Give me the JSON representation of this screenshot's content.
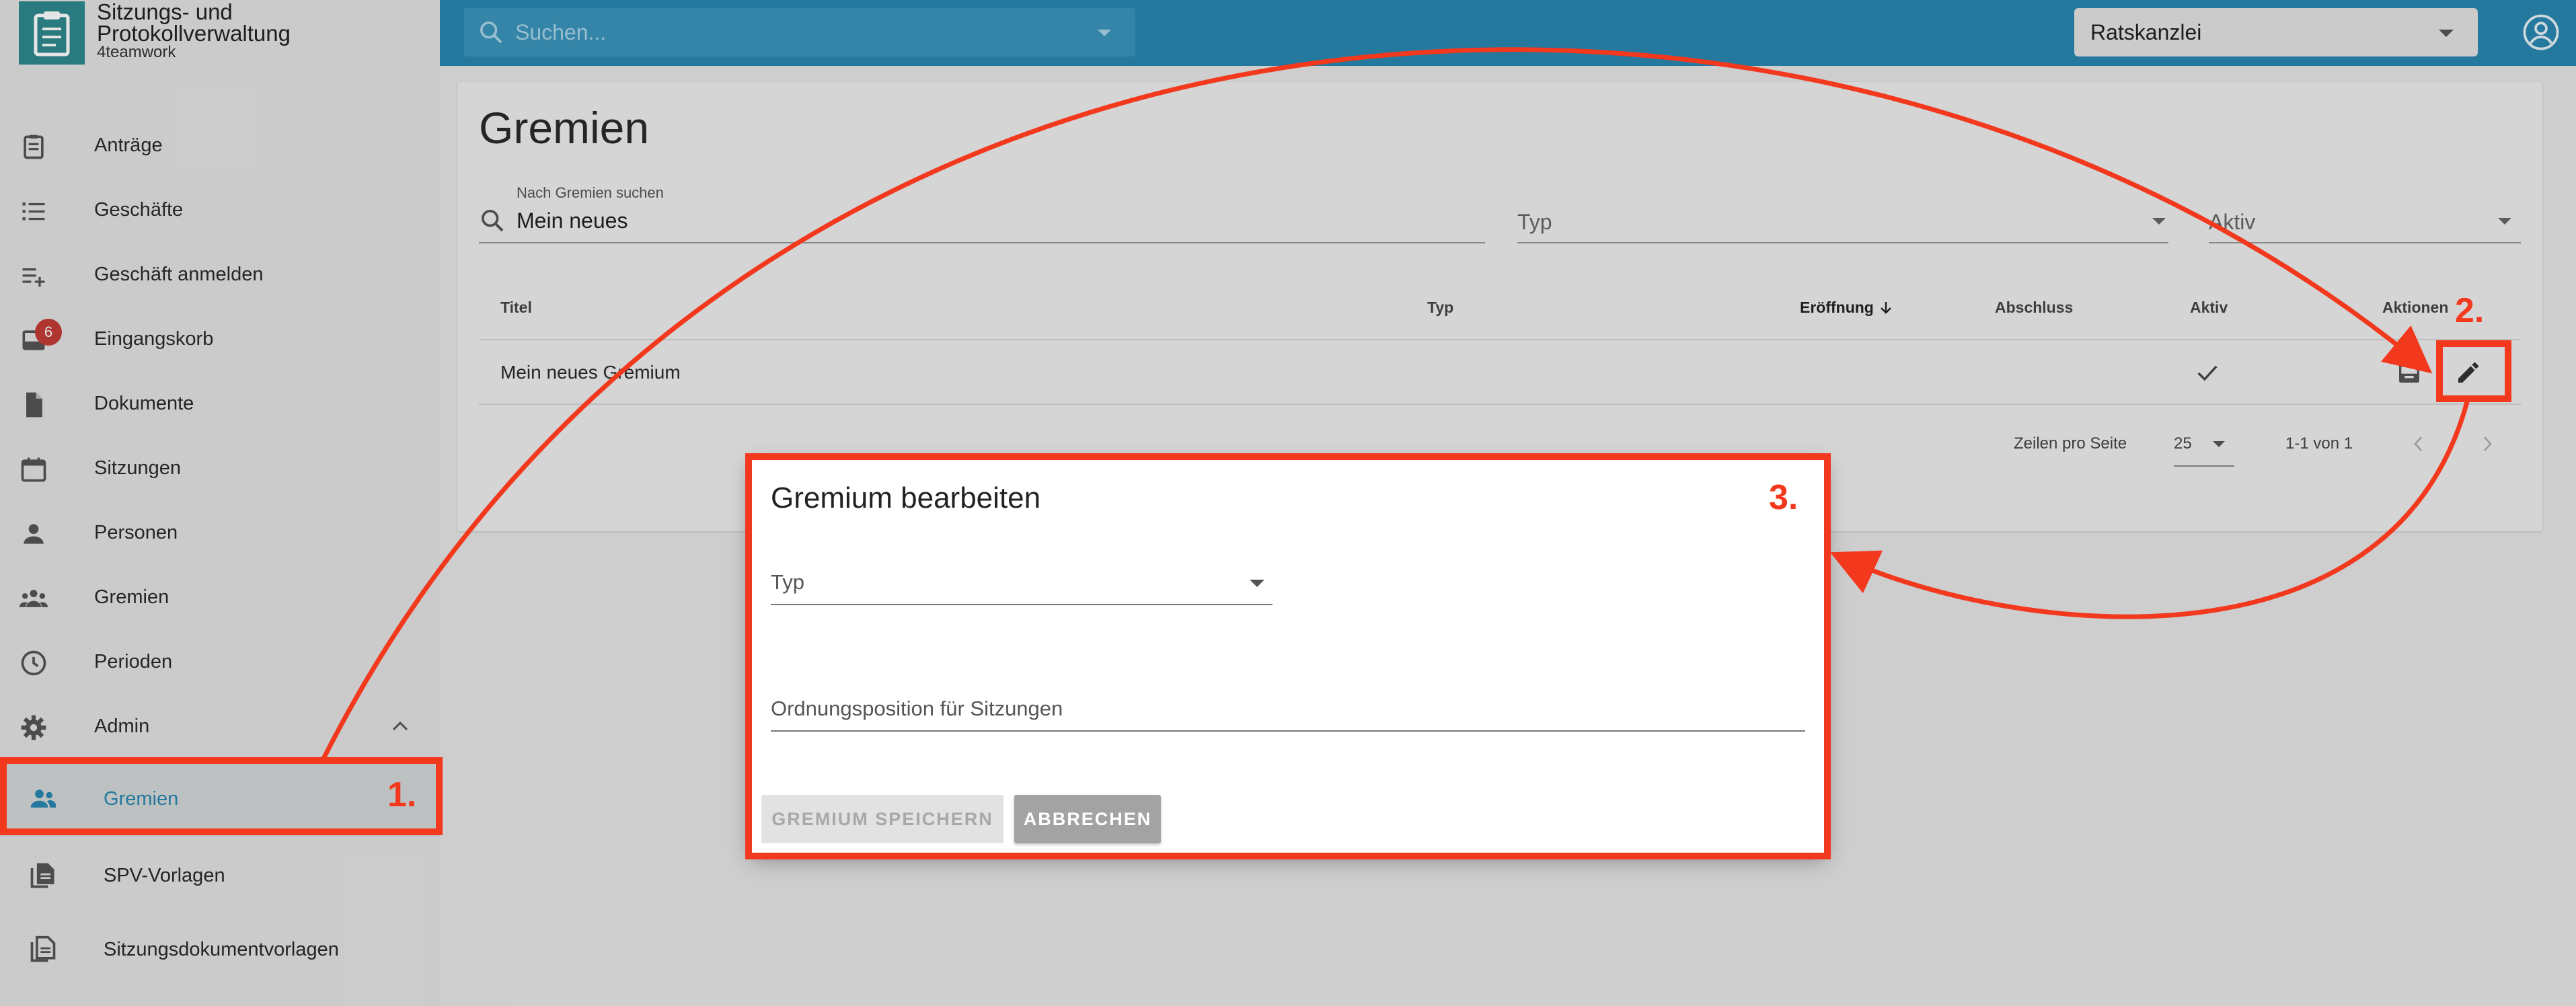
{
  "app": {
    "title": "Sitzungs- und Protokollverwaltung",
    "subtitle": "4teamwork"
  },
  "search": {
    "placeholder": "Suchen..."
  },
  "org_select": {
    "value": "Ratskanzlei"
  },
  "sidebar": {
    "items": [
      {
        "label": "Anträge",
        "icon": "clipboard-icon"
      },
      {
        "label": "Geschäfte",
        "icon": "list-icon"
      },
      {
        "label": "Geschäft anmelden",
        "icon": "playlist-add-icon"
      },
      {
        "label": "Eingangskorb",
        "icon": "inbox-icon",
        "badge": "6"
      },
      {
        "label": "Dokumente",
        "icon": "document-icon"
      },
      {
        "label": "Sitzungen",
        "icon": "calendar-icon"
      },
      {
        "label": "Personen",
        "icon": "person-icon"
      },
      {
        "label": "Gremien",
        "icon": "group-icon"
      },
      {
        "label": "Perioden",
        "icon": "clock-icon"
      },
      {
        "label": "Admin",
        "icon": "gear-icon"
      }
    ],
    "sub_items": [
      {
        "label": "Gremien",
        "icon": "group-icon",
        "active": true
      },
      {
        "label": "SPV-Vorlagen",
        "icon": "document-multi-icon"
      },
      {
        "label": "Sitzungsdokumentvorlagen",
        "icon": "document-multi-icon"
      }
    ]
  },
  "main": {
    "title": "Gremien",
    "filter": {
      "label": "Nach Gremien suchen",
      "value": "Mein neues",
      "typ_label": "Typ",
      "aktiv_label": "Aktiv"
    },
    "table": {
      "columns": [
        "Titel",
        "Typ",
        "Eröffnung",
        "Abschluss",
        "Aktiv",
        "Aktionen"
      ],
      "rows": [
        {
          "titel": "Mein neues Gremium",
          "typ": "",
          "eroeffnung": "",
          "abschluss": "",
          "aktiv": true
        }
      ]
    },
    "pagination": {
      "rows_per_page_label": "Zeilen pro Seite",
      "rows_per_page": "25",
      "range": "1-1 von 1"
    }
  },
  "dialog": {
    "title": "Gremium bearbeiten",
    "typ_label": "Typ",
    "ordnung_label": "Ordnungsposition für Sitzungen",
    "save_label": "GREMIUM SPEICHERN",
    "cancel_label": "ABBRECHEN"
  },
  "annotations": {
    "step1": "1.",
    "step2": "2.",
    "step3": "3."
  },
  "colors": {
    "accent": "#2a87b0",
    "annotation": "#f2381d",
    "badge": "#c23b36"
  }
}
